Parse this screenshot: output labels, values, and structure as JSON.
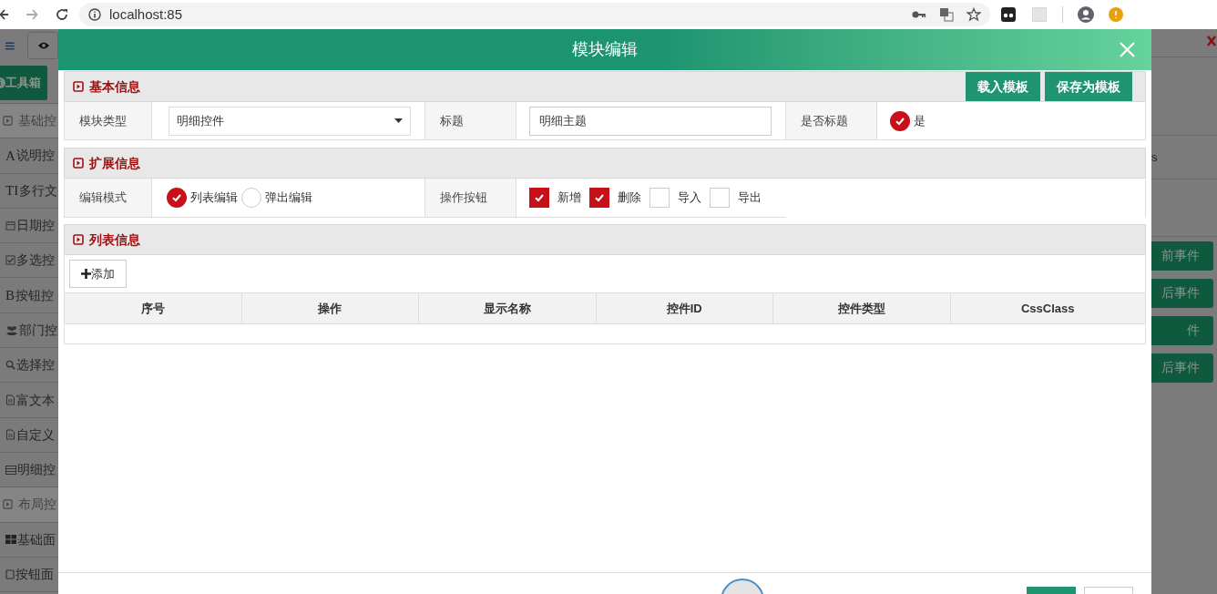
{
  "browser": {
    "url": "localhost:85"
  },
  "background": {
    "toolbox_button": "工具箱",
    "sidebar_items": [
      {
        "kind": "group",
        "text": "基础控"
      },
      {
        "kind": "glyph",
        "glyph": "A",
        "text": "说明控"
      },
      {
        "kind": "glyph",
        "glyph": "TI",
        "text": "多行文"
      },
      {
        "kind": "calendar",
        "text": "日期控"
      },
      {
        "kind": "check",
        "text": "多选控"
      },
      {
        "kind": "glyph",
        "glyph": "B",
        "text": "按钮控"
      },
      {
        "kind": "users",
        "text": "部门控"
      },
      {
        "kind": "search",
        "text": "选择控"
      },
      {
        "kind": "file",
        "text": "富文本"
      },
      {
        "kind": "file",
        "text": "自定义"
      },
      {
        "kind": "table",
        "text": "明细控"
      },
      {
        "kind": "group",
        "text": "布局控"
      },
      {
        "kind": "grid",
        "text": "基础面"
      },
      {
        "kind": "square",
        "text": "按钮面"
      }
    ],
    "right_text": "s",
    "right_buttons": [
      "前事件",
      "后事件",
      "件",
      "后事件"
    ]
  },
  "modal": {
    "title": "模块编辑",
    "basic": {
      "title": "基本信息",
      "buttons": [
        "载入模板",
        "保存为模板"
      ],
      "module_type": {
        "label": "模块类型",
        "value": "明细控件"
      },
      "heading": {
        "label": "标题",
        "value": "明细主题"
      },
      "is_heading": {
        "label": "是否标题",
        "option": "是",
        "checked": true
      }
    },
    "extended": {
      "title": "扩展信息",
      "edit_mode": {
        "label": "编辑模式",
        "options": [
          {
            "label": "列表编辑",
            "selected": true
          },
          {
            "label": "弹出编辑",
            "selected": false
          }
        ]
      },
      "action_buttons": {
        "label": "操作按钮",
        "options": [
          {
            "label": "新增",
            "checked": true
          },
          {
            "label": "删除",
            "checked": true
          },
          {
            "label": "导入",
            "checked": false
          },
          {
            "label": "导出",
            "checked": false
          }
        ]
      }
    },
    "list": {
      "title": "列表信息",
      "add_button": "添加",
      "table": {
        "columns": [
          "序号",
          "操作",
          "显示名称",
          "控件ID",
          "控件类型",
          "CssClass"
        ]
      }
    }
  }
}
